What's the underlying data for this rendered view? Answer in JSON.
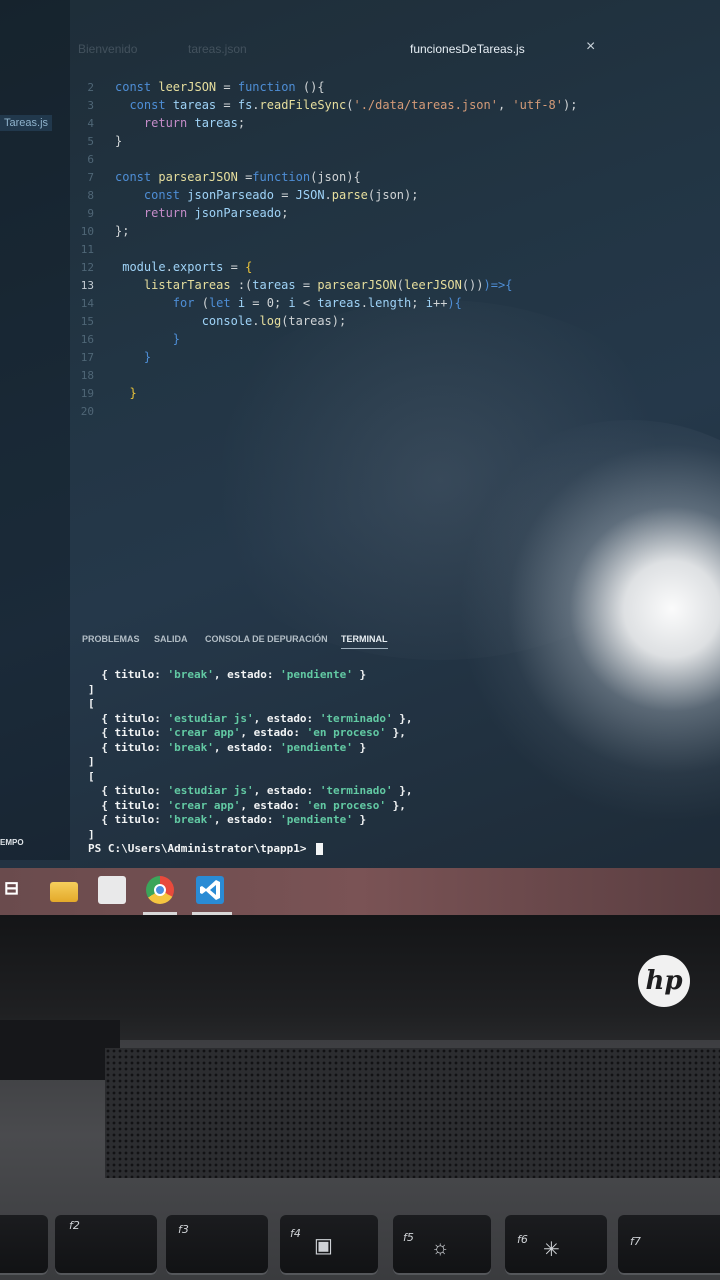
{
  "editor": {
    "tabs": [
      "Bienvenido",
      "tareas.json",
      "funcionesDeTareas.js"
    ],
    "active_tab": "funcionesDeTareas.js",
    "close_glyph": "×",
    "explorer_file": "Tareas.js",
    "current_line": "13",
    "lines": [
      {
        "n": "2",
        "tokens": [
          [
            "const ",
            "kw"
          ],
          [
            "leerJSON ",
            "fn"
          ],
          [
            "= ",
            "pun"
          ],
          [
            "function ",
            "kw"
          ],
          [
            "(){",
            "pun"
          ]
        ]
      },
      {
        "n": "3",
        "tokens": [
          [
            "  "
          ],
          [
            "const ",
            "kw"
          ],
          [
            "tareas ",
            "var"
          ],
          [
            "= ",
            "pun"
          ],
          [
            "fs",
            "var"
          ],
          [
            ".",
            "pun"
          ],
          [
            "readFileSync",
            "fn"
          ],
          [
            "(",
            "pun"
          ],
          [
            "'./data/tareas.json'",
            "str"
          ],
          [
            ", ",
            "pun"
          ],
          [
            "'utf-8'",
            "str"
          ],
          [
            ");",
            "pun"
          ]
        ]
      },
      {
        "n": "4",
        "tokens": [
          [
            "    "
          ],
          [
            "return ",
            "ctl"
          ],
          [
            "tareas",
            "var"
          ],
          [
            ";",
            "pun"
          ]
        ]
      },
      {
        "n": "5",
        "tokens": [
          [
            "}",
            "pun"
          ]
        ]
      },
      {
        "n": "6",
        "tokens": []
      },
      {
        "n": "7",
        "tokens": [
          [
            "const ",
            "kw"
          ],
          [
            "parsearJSON ",
            "fn"
          ],
          [
            "=",
            "pun"
          ],
          [
            "function",
            "kw"
          ],
          [
            "(json){",
            "pun"
          ]
        ]
      },
      {
        "n": "8",
        "tokens": [
          [
            "    "
          ],
          [
            "const ",
            "kw"
          ],
          [
            "jsonParseado ",
            "var"
          ],
          [
            "= ",
            "pun"
          ],
          [
            "JSON",
            "var"
          ],
          [
            ".",
            "pun"
          ],
          [
            "parse",
            "fn"
          ],
          [
            "(json);",
            "pun"
          ]
        ]
      },
      {
        "n": "9",
        "tokens": [
          [
            "    "
          ],
          [
            "return ",
            "ctl"
          ],
          [
            "jsonParseado",
            "var"
          ],
          [
            ";",
            "pun"
          ]
        ]
      },
      {
        "n": "10",
        "tokens": [
          [
            "};",
            "pun"
          ]
        ]
      },
      {
        "n": "11",
        "tokens": []
      },
      {
        "n": "12",
        "tokens": [
          [
            " module",
            "var"
          ],
          [
            ".",
            "pun"
          ],
          [
            "exports ",
            "var"
          ],
          [
            "= ",
            "pun"
          ],
          [
            "{",
            "brace"
          ]
        ]
      },
      {
        "n": "13",
        "tokens": [
          [
            "    "
          ],
          [
            "listarTareas ",
            "fn"
          ],
          [
            ":(",
            "pun"
          ],
          [
            "tareas ",
            "var"
          ],
          [
            "= ",
            "pun"
          ],
          [
            "parsearJSON",
            "fn"
          ],
          [
            "(",
            "pun"
          ],
          [
            "leerJSON",
            "fn"
          ],
          [
            "())",
            "pun"
          ],
          [
            ")=>{",
            "kw"
          ]
        ]
      },
      {
        "n": "14",
        "tokens": [
          [
            "        "
          ],
          [
            "for ",
            "kw"
          ],
          [
            "(",
            "pun"
          ],
          [
            "let ",
            "kw"
          ],
          [
            "i ",
            "var"
          ],
          [
            "= 0; ",
            "pun"
          ],
          [
            "i ",
            "var"
          ],
          [
            "< ",
            "pun"
          ],
          [
            "tareas",
            "var"
          ],
          [
            ".",
            "pun"
          ],
          [
            "length",
            "var"
          ],
          [
            "; ",
            "pun"
          ],
          [
            "i",
            "var"
          ],
          [
            "++",
            "pun"
          ],
          [
            "){",
            "kw"
          ]
        ]
      },
      {
        "n": "15",
        "tokens": [
          [
            "            "
          ],
          [
            "console",
            "var"
          ],
          [
            ".",
            "pun"
          ],
          [
            "log",
            "fn"
          ],
          [
            "(tareas);",
            "pun"
          ]
        ]
      },
      {
        "n": "16",
        "tokens": [
          [
            "        "
          ],
          [
            "}",
            "kw"
          ]
        ]
      },
      {
        "n": "17",
        "tokens": [
          [
            "    "
          ],
          [
            "}",
            "kw"
          ]
        ]
      },
      {
        "n": "18",
        "tokens": []
      },
      {
        "n": "19",
        "tokens": [
          [
            "  "
          ],
          [
            "}",
            "brace"
          ]
        ]
      },
      {
        "n": "20",
        "tokens": []
      }
    ]
  },
  "panel": {
    "tabs": [
      "PROBLEMAS",
      "SALIDA",
      "CONSOLA DE DEPURACIÓN",
      "TERMINAL"
    ],
    "active_tab": "TERMINAL"
  },
  "terminal": {
    "lines": [
      [
        [
          "  { titulo: "
        ],
        [
          "'break'",
          "s"
        ],
        [
          ", estado: "
        ],
        [
          "'pendiente'",
          "s"
        ],
        [
          " }"
        ]
      ],
      [
        [
          "]"
        ]
      ],
      [
        [
          "["
        ]
      ],
      [
        [
          "  { titulo: "
        ],
        [
          "'estudiar js'",
          "s"
        ],
        [
          ", estado: "
        ],
        [
          "'terminado'",
          "s"
        ],
        [
          " },"
        ]
      ],
      [
        [
          "  { titulo: "
        ],
        [
          "'crear app'",
          "s"
        ],
        [
          ", estado: "
        ],
        [
          "'en proceso'",
          "s"
        ],
        [
          " },"
        ]
      ],
      [
        [
          "  { titulo: "
        ],
        [
          "'break'",
          "s"
        ],
        [
          ", estado: "
        ],
        [
          "'pendiente'",
          "s"
        ],
        [
          " }"
        ]
      ],
      [
        [
          "]"
        ]
      ],
      [
        [
          "["
        ]
      ],
      [
        [
          "  { titulo: "
        ],
        [
          "'estudiar js'",
          "s"
        ],
        [
          ", estado: "
        ],
        [
          "'terminado'",
          "s"
        ],
        [
          " },"
        ]
      ],
      [
        [
          "  { titulo: "
        ],
        [
          "'crear app'",
          "s"
        ],
        [
          ", estado: "
        ],
        [
          "'en proceso'",
          "s"
        ],
        [
          " },"
        ]
      ],
      [
        [
          "  { titulo: "
        ],
        [
          "'break'",
          "s"
        ],
        [
          ", estado: "
        ],
        [
          "'pendiente'",
          "s"
        ],
        [
          " }"
        ]
      ],
      [
        [
          "]"
        ]
      ],
      [
        [
          "PS C:\\Users\\Administrator\\tpapp1> "
        ]
      ]
    ]
  },
  "status_left": "EMPO",
  "taskbar": {
    "icons": [
      "task-view-icon",
      "file-explorer-icon",
      "store-icon",
      "chrome-icon",
      "vscode-icon"
    ],
    "task_view_glyph": "⊟"
  },
  "laptop": {
    "logo": "hp",
    "fkeys": [
      "f2",
      "f3",
      "f4",
      "f5",
      "f6",
      "f7"
    ]
  }
}
